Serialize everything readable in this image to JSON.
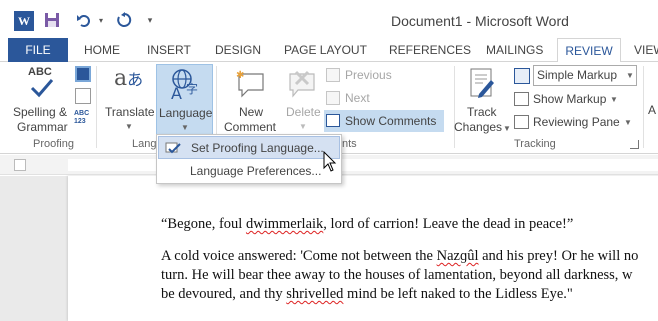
{
  "window": {
    "title": "Document1 - Microsoft Word"
  },
  "quick_access": {
    "word_logo": "W"
  },
  "tabs": [
    "FILE",
    "HOME",
    "INSERT",
    "DESIGN",
    "PAGE LAYOUT",
    "REFERENCES",
    "MAILINGS",
    "REVIEW",
    "VIEW"
  ],
  "active_tab": "REVIEW",
  "ribbon": {
    "proofing": {
      "label": "Proofing",
      "abc": "ABC",
      "spelling_line1": "Spelling &",
      "spelling_line2": "Grammar",
      "abc123": "ABC\n123"
    },
    "language_group": {
      "label": "Lang",
      "translate": "Translate",
      "language": "Language"
    },
    "comments": {
      "label": "nts",
      "new_comment_line1": "New",
      "new_comment_line2": "Comment",
      "delete": "Delete",
      "previous": "Previous",
      "next": "Next",
      "show_comments": "Show Comments"
    },
    "tracking": {
      "label": "Tracking",
      "track_changes_line1": "Track",
      "track_changes_line2": "Changes",
      "simple_markup": "Simple Markup",
      "show_markup": "Show Markup",
      "reviewing_pane": "Reviewing Pane",
      "partial": "A"
    }
  },
  "language_menu": {
    "items": [
      "Set Proofing Language...",
      "Language Preferences..."
    ]
  },
  "document": {
    "para1": "“Begone, foul dwimmerlaik, lord of carrion! Leave the dead in peace!”",
    "para2_line1": "A cold voice answered: 'Come not between the Nazɡûl and his prey! Or he will no",
    "para2_line2": "turn. He will bear thee away to the houses of lamentation, beyond all darkness, w",
    "para2_line3": "be devoured, and thy shrivelled mind be left naked to the Lidless Eye.\""
  },
  "colors": {
    "accent": "#2b579a",
    "highlight": "#c5dbf0"
  }
}
